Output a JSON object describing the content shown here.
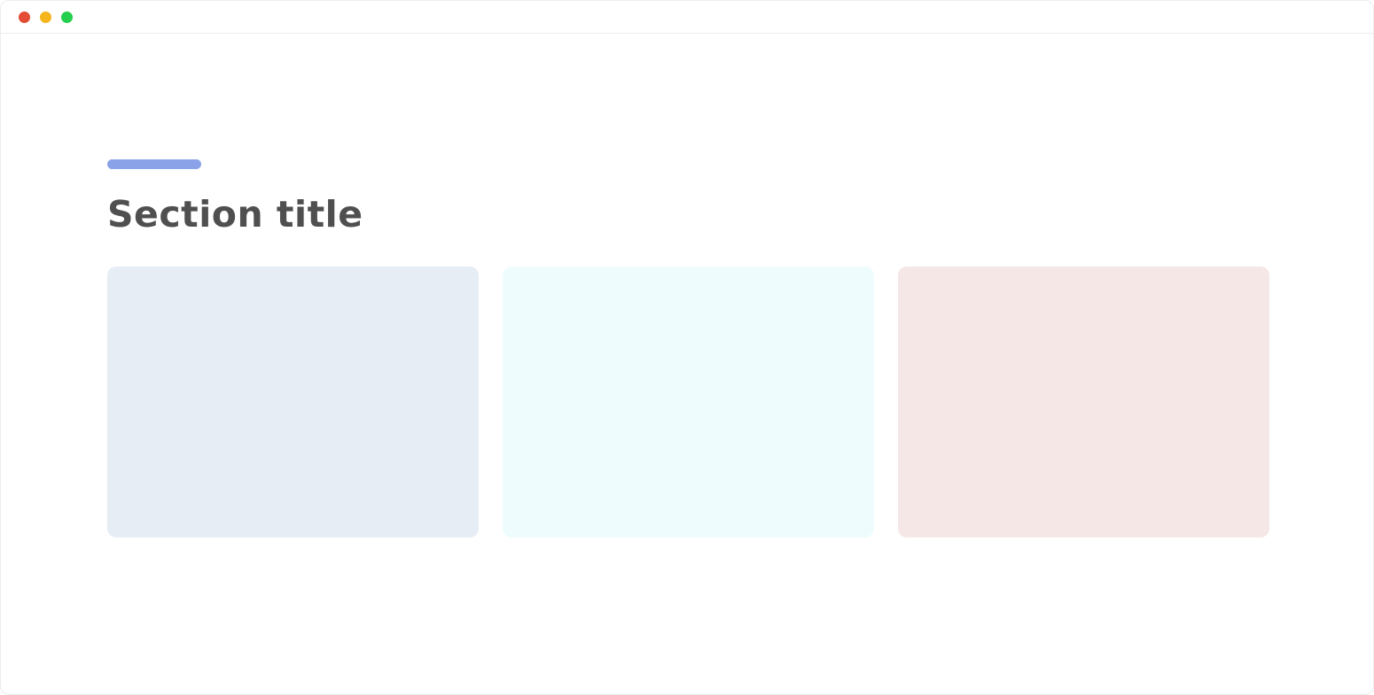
{
  "window": {
    "controls": [
      {
        "name": "close-button",
        "color": "#e34b35"
      },
      {
        "name": "minimize-button",
        "color": "#f5b51d"
      },
      {
        "name": "zoom-button",
        "color": "#23cf4c"
      }
    ]
  },
  "section": {
    "title": "Section title",
    "accent_color": "#8aa2e8",
    "title_color": "#4f4f4f"
  },
  "cards": [
    {
      "color": "#e7edf5"
    },
    {
      "color": "#effcfd"
    },
    {
      "color": "#f6e7e7"
    }
  ]
}
